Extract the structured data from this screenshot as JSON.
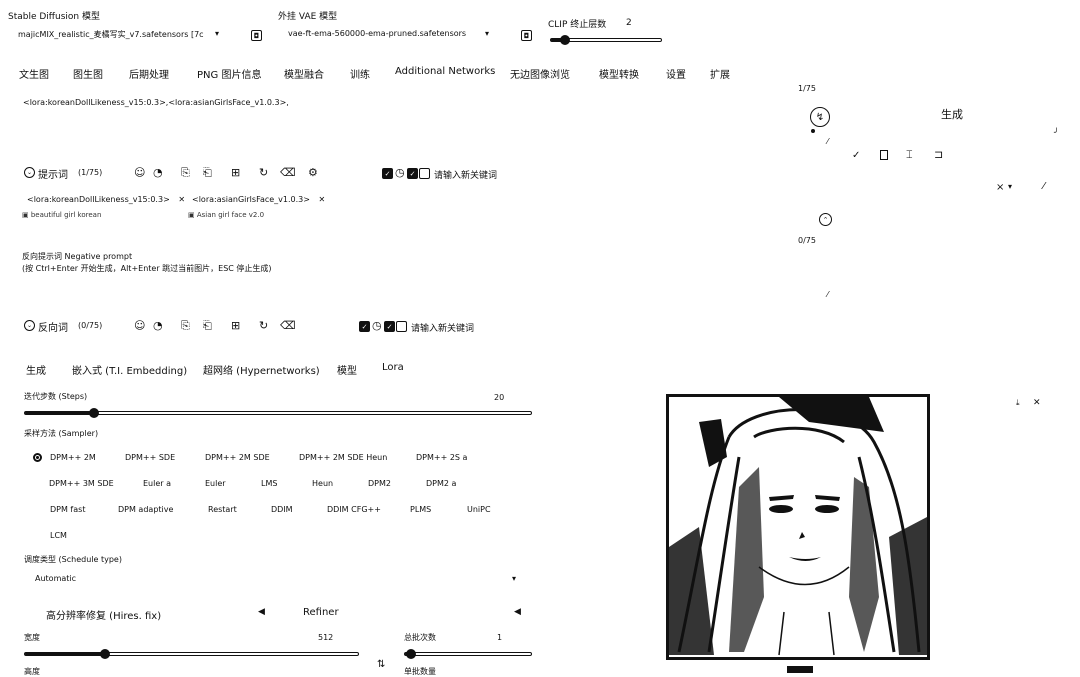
{
  "model": {
    "label": "Stable Diffusion 模型",
    "value": "majicMIX_realistic_麦橘写实_v7.safetensors [7c"
  },
  "vae": {
    "label": "外挂 VAE 模型",
    "value": "vae-ft-ema-560000-ema-pruned.safetensors"
  },
  "clip": {
    "label": "CLIP 终止层数",
    "value": "2"
  },
  "tabs": [
    "文生图",
    "图生图",
    "后期处理",
    "PNG 图片信息",
    "模型融合",
    "训练",
    "Additional Networks",
    "无边图像浏览",
    "模型转换",
    "设置",
    "扩展"
  ],
  "prompt": {
    "text": "<lora:koreanDollLikeness_v15:0.3>,<lora:asianGirlsFace_v1.0.3>,",
    "title": "提示词",
    "count": "(1/75)",
    "counter_right": "1/75",
    "keyword_placeholder": "请输入新关键词",
    "chips": [
      "<lora:koreanDollLikeness_v15:0.3>",
      "<lora:asianGirlsFace_v1.0.3>"
    ],
    "chip_subs": [
      "beautiful girl korean",
      "Asian girl face v2.0"
    ]
  },
  "negative": {
    "hint_title": "反向提示词 Negative prompt",
    "hint_text": "(按 Ctrl+Enter 开始生成，Alt+Enter 跳过当前图片，ESC 停止生成)",
    "title": "反向词",
    "count": "(0/75)",
    "counter_right": "0/75",
    "keyword_placeholder": "请输入新关键词"
  },
  "generate_label": "生成",
  "subtabs": [
    "生成",
    "嵌入式 (T.I. Embedding)",
    "超网络 (Hypernetworks)",
    "模型",
    "Lora"
  ],
  "steps": {
    "label": "迭代步数 (Steps)",
    "value": "20"
  },
  "sampler": {
    "label": "采样方法 (Sampler)",
    "options": [
      "DPM++ 2M",
      "DPM++ SDE",
      "DPM++ 2M SDE",
      "DPM++ 2M SDE Heun",
      "DPM++ 2S a",
      "DPM++ 3M SDE",
      "Euler a",
      "Euler",
      "LMS",
      "Heun",
      "DPM2",
      "DPM2 a",
      "DPM fast",
      "DPM adaptive",
      "Restart",
      "DDIM",
      "DDIM CFG++",
      "PLMS",
      "UniPC",
      "LCM"
    ],
    "selected": "DPM++ 2M"
  },
  "schedule": {
    "label": "调度类型 (Schedule type)",
    "value": "Automatic"
  },
  "hires": {
    "label": "高分辨率修复 (Hires. fix)"
  },
  "refiner": {
    "label": "Refiner"
  },
  "width": {
    "label": "宽度",
    "value": "512"
  },
  "batch_count": {
    "label": "总批次数",
    "value": "1"
  },
  "height_label": "高度",
  "batch_size_label": "单批数量",
  "colors": {
    "ink": "#111111",
    "bg": "#ffffff"
  }
}
